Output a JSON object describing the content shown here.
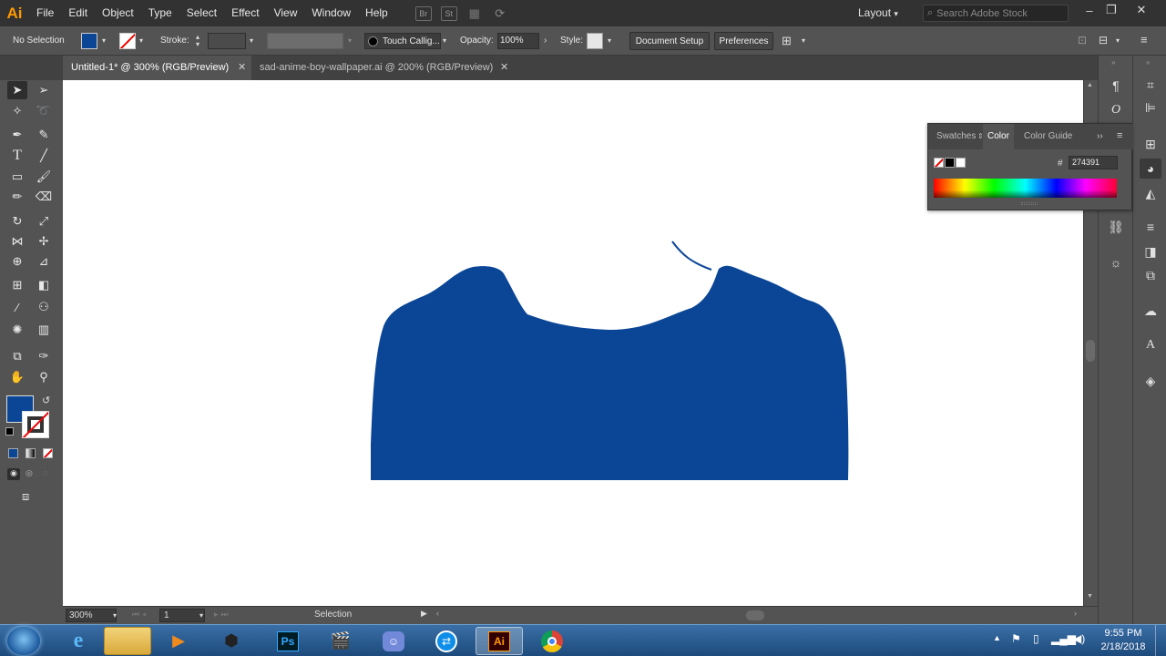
{
  "app": {
    "logo": "Ai"
  },
  "menu": [
    "File",
    "Edit",
    "Object",
    "Type",
    "Select",
    "Effect",
    "View",
    "Window",
    "Help"
  ],
  "menubar_icons": [
    "Br",
    "St"
  ],
  "workspace": "Layout",
  "search": {
    "placeholder": "Search Adobe Stock"
  },
  "controls": {
    "selection_status": "No Selection",
    "stroke_label": "Stroke:",
    "brush": "Touch Callig...",
    "opacity_label": "Opacity:",
    "opacity_value": "100%",
    "style_label": "Style:",
    "document_setup": "Document Setup",
    "preferences": "Preferences"
  },
  "tabs": [
    {
      "title": "Untitled-1* @ 300% (RGB/Preview)",
      "active": true
    },
    {
      "title": "sad-anime-boy-wallpaper.ai @ 200% (RGB/Preview)",
      "active": false
    }
  ],
  "color_panel": {
    "tabs": [
      "Swatches",
      "Color",
      "Color Guide"
    ],
    "active_tab": "Color",
    "hex_label": "#",
    "hex_value": "274391"
  },
  "status": {
    "zoom": "300%",
    "artboard": "1",
    "tool": "Selection"
  },
  "colors": {
    "fill": "#0a4596",
    "shape": "#0a4596"
  },
  "taskbar": {
    "time": "9:55 PM",
    "date": "2/18/2018",
    "ps_label": "Ps",
    "ai_label": "Ai"
  }
}
